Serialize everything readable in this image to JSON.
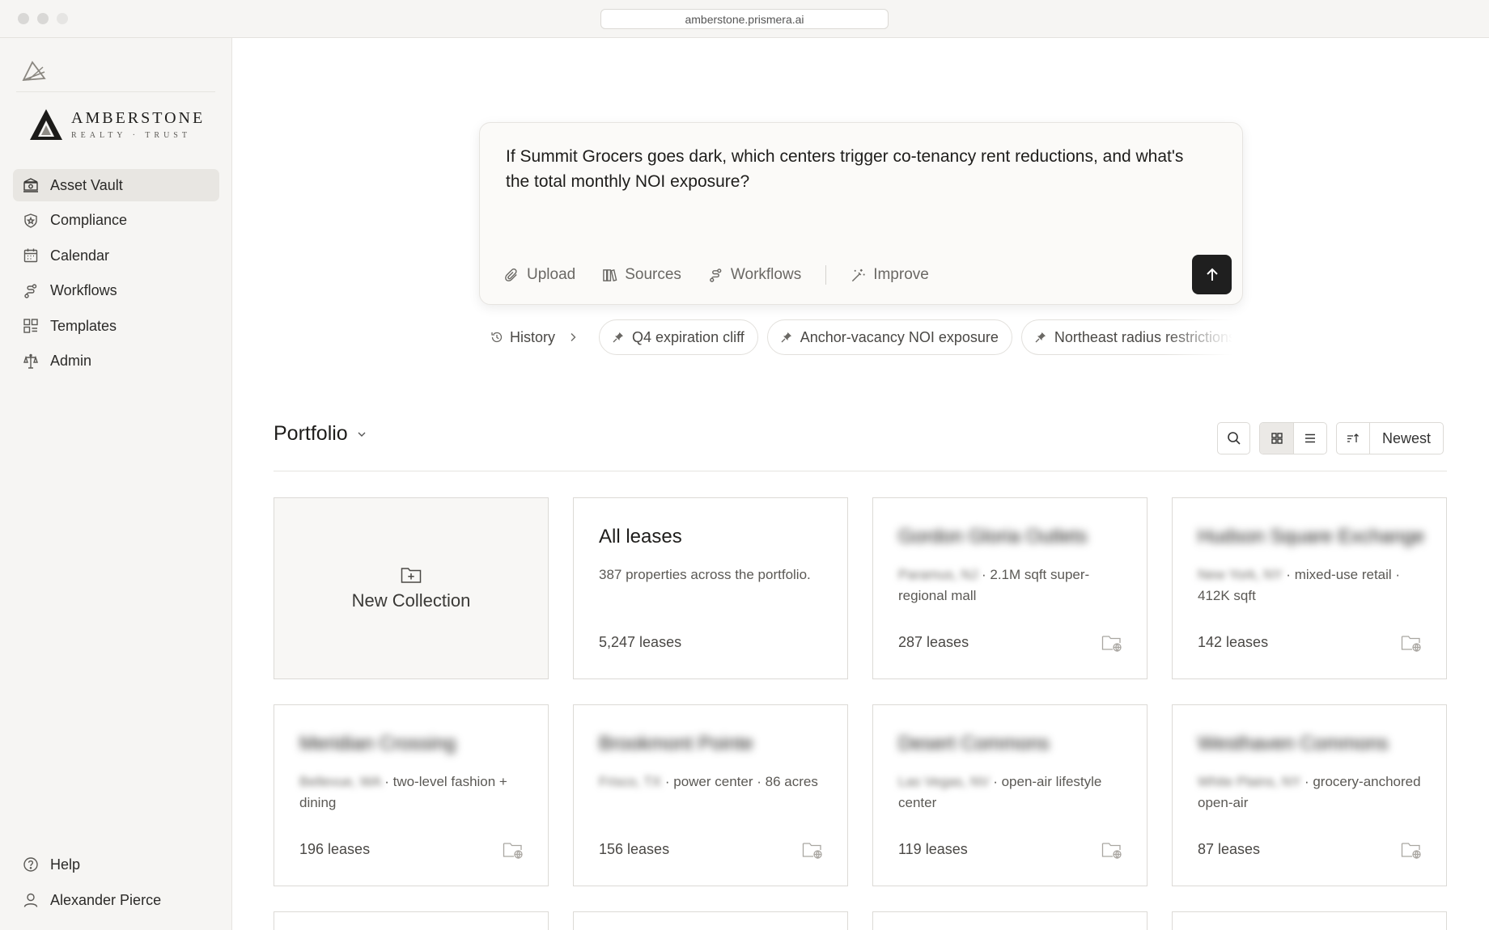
{
  "browser": {
    "url": "amberstone.prismera.ai"
  },
  "brand": {
    "name": "AMBERSTONE",
    "subtitle": "REALTY · TRUST"
  },
  "sidebar": {
    "items": [
      {
        "label": "Asset Vault",
        "icon": "vault-icon",
        "active": true
      },
      {
        "label": "Compliance",
        "icon": "shield-icon"
      },
      {
        "label": "Calendar",
        "icon": "calendar-icon"
      },
      {
        "label": "Workflows",
        "icon": "workflow-icon"
      },
      {
        "label": "Templates",
        "icon": "templates-icon"
      },
      {
        "label": "Admin",
        "icon": "admin-icon"
      }
    ],
    "bottom": [
      {
        "label": "Help",
        "icon": "help-icon"
      },
      {
        "label": "Alexander Pierce",
        "icon": "user-icon"
      }
    ]
  },
  "prompt": {
    "text": "If Summit Grocers goes dark, which centers trigger co-tenancy rent reductions, and what's the total monthly NOI exposure?",
    "tools": {
      "upload": "Upload",
      "sources": "Sources",
      "workflows": "Workflows",
      "improve": "Improve"
    }
  },
  "suggestions": {
    "history": "History",
    "chips": [
      "Q4 expiration cliff",
      "Anchor-vacancy NOI exposure",
      "Northeast radius restrictions"
    ]
  },
  "portfolio": {
    "title": "Portfolio",
    "sort": "Newest",
    "new_collection": "New Collection",
    "all_leases": {
      "title": "All leases",
      "desc": "387 properties across the portfolio.",
      "count": "5,247 leases"
    },
    "cards": [
      {
        "title": "Gordon Gloria Outlets",
        "location": "Paramus, NJ",
        "desc": "2.1M sqft super-regional mall",
        "count": "287 leases"
      },
      {
        "title": "Hudson Square Exchange",
        "location": "New York, NY",
        "desc": "mixed-use retail · 412K sqft",
        "count": "142 leases"
      },
      {
        "title": "Meridian Crossing",
        "location": "Bellevue, WA",
        "desc": "two-level fashion + dining",
        "count": "196 leases"
      },
      {
        "title": "Brookmont Pointe",
        "location": "Frisco, TX",
        "desc": "power center · 86 acres",
        "count": "156 leases"
      },
      {
        "title": "Desert Commons",
        "location": "Las Vegas, NV",
        "desc": "open-air lifestyle center",
        "count": "119 leases"
      },
      {
        "title": "Westhaven Commons",
        "location": "White Plains, NY",
        "desc": "grocery-anchored open-air",
        "count": "87 leases"
      }
    ]
  }
}
